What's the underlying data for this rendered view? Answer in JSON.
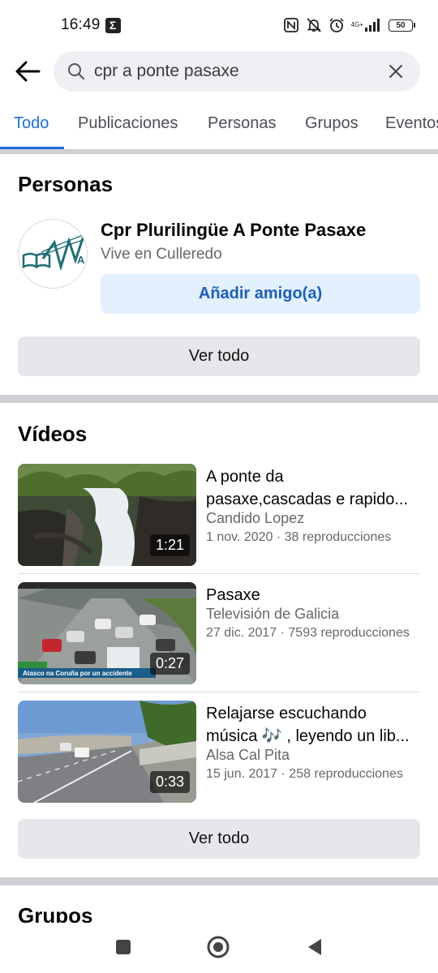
{
  "status": {
    "time": "16:49",
    "sigma": "Σ",
    "network": "4G+",
    "battery": "50"
  },
  "search": {
    "query": "cpr a ponte pasaxe"
  },
  "tabs": [
    {
      "label": "Todo"
    },
    {
      "label": "Publicaciones"
    },
    {
      "label": "Personas"
    },
    {
      "label": "Grupos"
    },
    {
      "label": "Eventos"
    }
  ],
  "people": {
    "title": "Personas",
    "name": "Cpr Plurilingüe A Ponte Pasaxe",
    "subtitle": "Vive en Culleredo",
    "add_friend": "Añadir amigo(a)",
    "see_all": "Ver todo"
  },
  "videos": {
    "title": "Vídeos",
    "see_all": "Ver todo",
    "items": [
      {
        "title_line1": "A ponte da",
        "title_line2": "pasaxe,cascadas e rapido...",
        "channel": "Candido Lopez",
        "meta": "1 nov. 2020 · 38 reproducciones",
        "duration": "1:21"
      },
      {
        "title_line1": "Pasaxe",
        "title_line2": "",
        "channel": "Televisión de Galicia",
        "meta": "27 dic. 2017 · 7593 reproducciones",
        "duration": "0:27",
        "thumb_caption": "Atasco na Coruña por un accidente"
      },
      {
        "title_line1": "Relajarse escuchando",
        "title_line2": "música 🎶 , leyendo un lib...",
        "channel": "Alsa Cal Pita",
        "meta": "15 jun. 2017 · 258 reproducciones",
        "duration": "0:33"
      }
    ]
  },
  "groups": {
    "title": "Grupos"
  }
}
